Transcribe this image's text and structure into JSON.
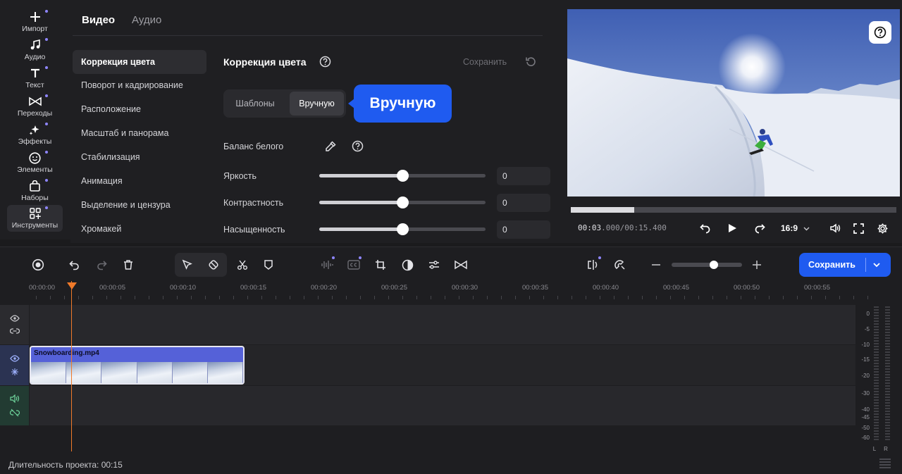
{
  "sidebar": {
    "items": [
      {
        "label": "Импорт",
        "icon": "plus-icon",
        "active": false
      },
      {
        "label": "Аудио",
        "icon": "music-note-icon",
        "active": false
      },
      {
        "label": "Текст",
        "icon": "text-icon",
        "active": false
      },
      {
        "label": "Переходы",
        "icon": "transitions-icon",
        "active": false
      },
      {
        "label": "Эффекты",
        "icon": "sparkles-icon",
        "active": false
      },
      {
        "label": "Элементы",
        "icon": "smiley-icon",
        "active": false
      },
      {
        "label": "Наборы",
        "icon": "bag-icon",
        "active": false
      },
      {
        "label": "Инструменты",
        "icon": "tools-grid-icon",
        "active": true
      }
    ],
    "accent_dot_color": "#8f86ff"
  },
  "tabs": [
    {
      "label": "Видео",
      "active": true
    },
    {
      "label": "Аудио",
      "active": false
    }
  ],
  "menu": {
    "items": [
      {
        "label": "Коррекция цвета",
        "active": true
      },
      {
        "label": "Поворот и кадрирование",
        "active": false
      },
      {
        "label": "Расположение",
        "active": false
      },
      {
        "label": "Масштаб и панорама",
        "active": false
      },
      {
        "label": "Стабилизация",
        "active": false
      },
      {
        "label": "Анимация",
        "active": false
      },
      {
        "label": "Выделение и цензура",
        "active": false
      },
      {
        "label": "Хромакей",
        "active": false
      }
    ]
  },
  "color_panel": {
    "title": "Коррекция цвета",
    "save_label": "Сохранить",
    "modes": [
      {
        "label": "Шаблоны",
        "active": false
      },
      {
        "label": "Вручную",
        "active": true
      }
    ],
    "tooltip": "Вручную",
    "white_balance_label": "Баланс белого",
    "sliders": [
      {
        "label": "Яркость",
        "value": "0",
        "fraction": 0.5
      },
      {
        "label": "Контрастность",
        "value": "0",
        "fraction": 0.5
      },
      {
        "label": "Насыщенность",
        "value": "0",
        "fraction": 0.5
      }
    ]
  },
  "preview": {
    "time_current": "00:03",
    "time_current_ms": ".000",
    "time_total": "/00:15.400",
    "progress_fraction": 0.195,
    "aspect_ratio": "16:9"
  },
  "timeline": {
    "ticks": [
      "00:00:00",
      "00:00:05",
      "00:00:10",
      "00:00:15",
      "00:00:20",
      "00:00:25",
      "00:00:30",
      "00:00:35",
      "00:00:40",
      "00:00:45",
      "00:00:50",
      "00:00:55"
    ],
    "clip_name": "Snowboarding.mp4",
    "save_label": "Сохранить",
    "zoom_fraction": 0.6,
    "vu_scale": [
      "0",
      "-5",
      "-10",
      "-15",
      "-20",
      "-30",
      "-40",
      "-45",
      "-50",
      "-60"
    ],
    "vu_channels": [
      "L",
      "R"
    ],
    "duration_label": "Длительность проекта: 00:15"
  },
  "colors": {
    "accent": "#1f5bf0",
    "playhead": "#f07a2a",
    "clip": "#5561d8"
  }
}
